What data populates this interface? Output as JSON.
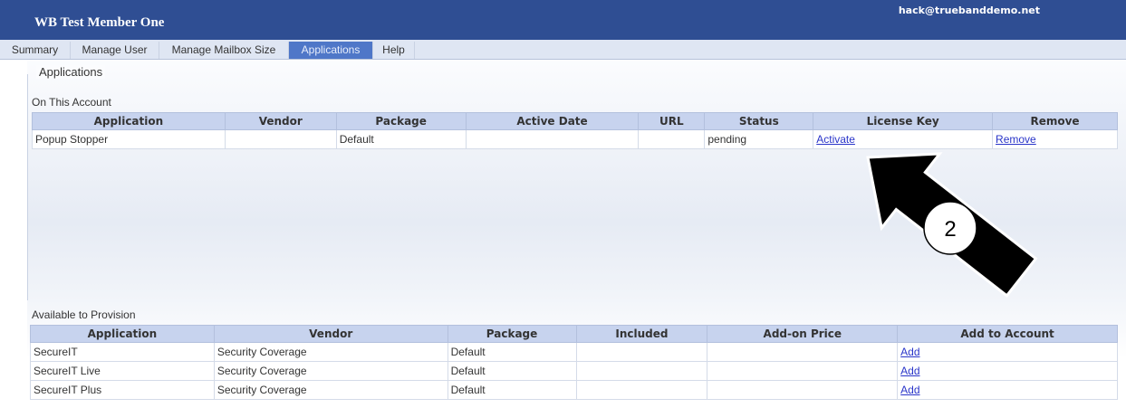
{
  "header": {
    "title": "WB Test Member One",
    "email": "hack@truebanddemo.net",
    "bg_color": "#2f4e93"
  },
  "tabs": [
    {
      "label": "Summary"
    },
    {
      "label": "Manage User"
    },
    {
      "label": "Manage Mailbox Size"
    },
    {
      "label": "Applications"
    },
    {
      "label": "Help"
    }
  ],
  "active_tab": "Applications",
  "section": {
    "legend": "Applications"
  },
  "on_account": {
    "label": "On This Account",
    "columns": [
      "Application",
      "Vendor",
      "Package",
      "Active Date",
      "URL",
      "Status",
      "License Key",
      "Remove"
    ],
    "rows": [
      {
        "application": "Popup Stopper",
        "vendor": "",
        "package": "Default",
        "active_date": "",
        "url": "",
        "status": "pending",
        "license_key": "Activate",
        "remove": "Remove"
      }
    ]
  },
  "available": {
    "label": "Available to Provision",
    "columns": [
      "Application",
      "Vendor",
      "Package",
      "Included",
      "Add-on Price",
      "Add to Account"
    ],
    "rows": [
      {
        "application": "SecureIT",
        "vendor": "Security Coverage",
        "package": "Default",
        "included": "",
        "addon_price": "",
        "action": "Add"
      },
      {
        "application": "SecureIT Live",
        "vendor": "Security Coverage",
        "package": "Default",
        "included": "",
        "addon_price": "",
        "action": "Add"
      },
      {
        "application": "SecureIT Plus",
        "vendor": "Security Coverage",
        "package": "Default",
        "included": "",
        "addon_price": "",
        "action": "Add"
      }
    ]
  },
  "annotation": {
    "number": "2"
  }
}
